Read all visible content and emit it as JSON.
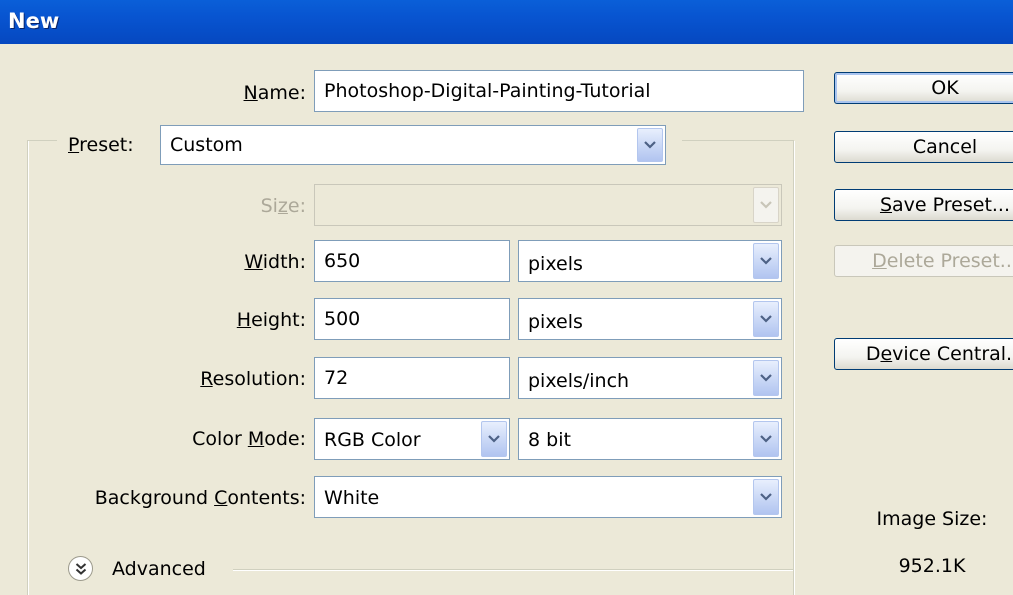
{
  "window": {
    "title": "New"
  },
  "form": {
    "name": {
      "label": "Name:",
      "accel": "N",
      "rest": "ame:",
      "value": "Photoshop-Digital-Painting-Tutorial"
    },
    "preset": {
      "label": "Preset:",
      "accel": "P",
      "rest": "reset:",
      "value": "Custom"
    },
    "size": {
      "label": "Size:",
      "pre": "Si",
      "accel": "z",
      "rest": "e:",
      "value": ""
    },
    "width": {
      "label": "Width:",
      "accel": "W",
      "rest": "idth:",
      "value": "650",
      "unit": "pixels"
    },
    "height": {
      "label": "Height:",
      "accel": "H",
      "rest": "eight:",
      "value": "500",
      "unit": "pixels"
    },
    "resolution": {
      "label": "Resolution:",
      "accel": "R",
      "rest": "esolution:",
      "value": "72",
      "unit": "pixels/inch"
    },
    "color_mode": {
      "label": "Color Mode:",
      "pre": "Color ",
      "accel": "M",
      "rest": "ode:",
      "value": "RGB Color",
      "depth": "8 bit"
    },
    "background": {
      "label": "Background Contents:",
      "pre": "Background ",
      "accel": "C",
      "rest": "ontents:",
      "value": "White"
    },
    "advanced": {
      "label": "Advanced"
    }
  },
  "buttons": {
    "ok": "OK",
    "cancel": "Cancel",
    "save_preset": {
      "label": "Save Preset...",
      "accel": "S",
      "rest": "ave Preset..."
    },
    "delete_preset": {
      "label": "Delete Preset...",
      "accel": "D",
      "rest": "elete Preset..."
    },
    "device_central": {
      "label": "Device Central...",
      "pre": "D",
      "accel": "e",
      "rest": "vice Central..."
    }
  },
  "image_size": {
    "label": "Image Size:",
    "value": "952.1K"
  },
  "colors": {
    "titlebar": "#0854D0",
    "dialog_bg": "#ECE9D8",
    "field_border": "#7F9DB9",
    "disabled_text": "#ACA899"
  }
}
